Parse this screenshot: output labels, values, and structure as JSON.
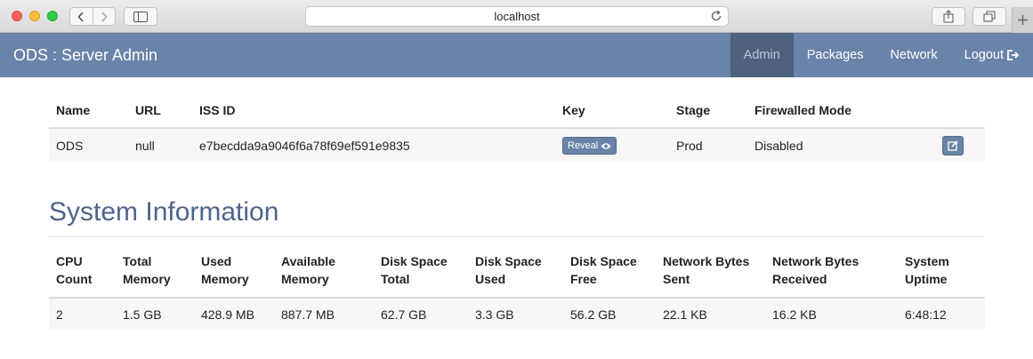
{
  "browser": {
    "url": "localhost"
  },
  "navbar": {
    "brand": "ODS : Server Admin",
    "links": [
      {
        "label": "Admin",
        "active": true
      },
      {
        "label": "Packages",
        "active": false
      },
      {
        "label": "Network",
        "active": false
      },
      {
        "label": "Logout",
        "active": false
      }
    ]
  },
  "server_table": {
    "headers": [
      "Name",
      "URL",
      "ISS ID",
      "Key",
      "Stage",
      "Firewalled Mode"
    ],
    "row": {
      "name": "ODS",
      "url": "null",
      "iss_id": "e7becdda9a9046f6a78f69ef591e9835",
      "key_button": "Reveal",
      "stage": "Prod",
      "firewalled_mode": "Disabled"
    }
  },
  "system_info": {
    "heading": "System Information",
    "headers": [
      [
        "CPU",
        "Count"
      ],
      [
        "Total",
        "Memory"
      ],
      [
        "Used",
        "Memory"
      ],
      [
        "Available",
        "Memory"
      ],
      [
        "Disk Space",
        "Total"
      ],
      [
        "Disk Space",
        "Used"
      ],
      [
        "Disk Space",
        "Free"
      ],
      [
        "Network Bytes",
        "Sent"
      ],
      [
        "Network Bytes",
        "Received"
      ],
      [
        "System",
        "Uptime"
      ]
    ],
    "values": [
      "2",
      "1.5 GB",
      "428.9 MB",
      "887.7 MB",
      "62.7 GB",
      "3.3 GB",
      "56.2 GB",
      "22.1 KB",
      "16.2 KB",
      "6:48:12"
    ]
  },
  "colors": {
    "navbar": "#6a83a8",
    "navbar_active": "#4e627f",
    "heading": "#50648a"
  }
}
